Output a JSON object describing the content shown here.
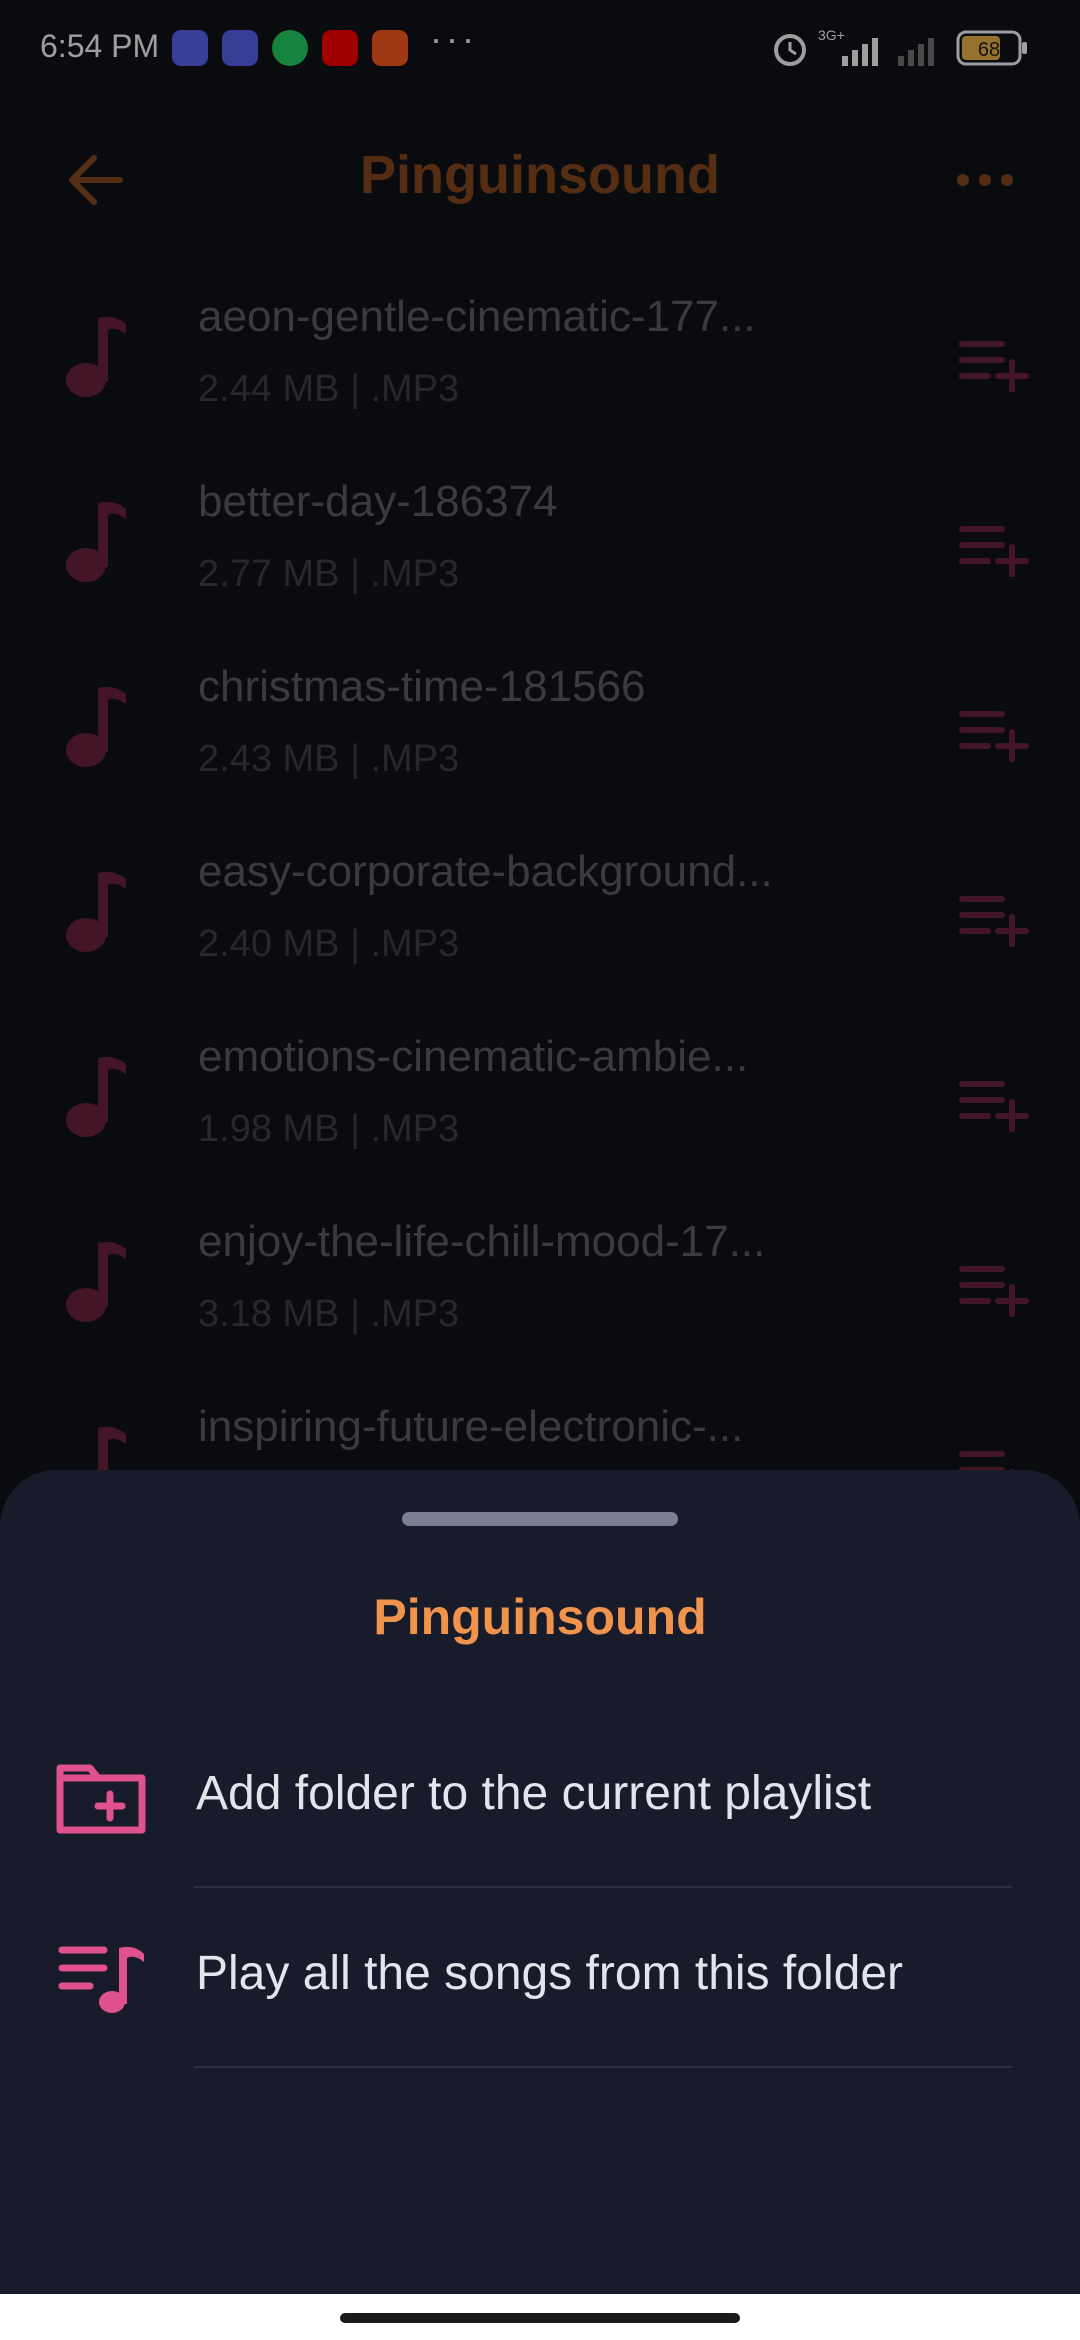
{
  "status_bar": {
    "time": "6:54 PM",
    "notifications": [
      "discord-icon",
      "discord-icon",
      "whatsapp-icon",
      "youtube-icon",
      "app-icon"
    ],
    "more": "···",
    "network": "3G+",
    "battery": "68"
  },
  "header": {
    "title": "Pinguinsound"
  },
  "songs": [
    {
      "name": "aeon-gentle-cinematic-177...",
      "meta": "2.44 MB  |  .MP3"
    },
    {
      "name": "better-day-186374",
      "meta": "2.77 MB  |  .MP3"
    },
    {
      "name": "christmas-time-181566",
      "meta": "2.43 MB  |  .MP3"
    },
    {
      "name": "easy-corporate-background...",
      "meta": "2.40 MB  |  .MP3"
    },
    {
      "name": "emotions-cinematic-ambie...",
      "meta": "1.98 MB  |  .MP3"
    },
    {
      "name": "enjoy-the-life-chill-mood-17...",
      "meta": "3.18 MB  |  .MP3"
    },
    {
      "name": "inspiring-future-electronic-...",
      "meta": ""
    }
  ],
  "sheet": {
    "title": "Pinguinsound",
    "options": [
      {
        "label": "Add folder to the current playlist",
        "icon": "folder-add-icon"
      },
      {
        "label": "Play all the songs from this folder",
        "icon": "playlist-play-icon"
      }
    ]
  },
  "colors": {
    "accent_orange": "#f0944d",
    "accent_pink": "#e0528f",
    "sheet_bg": "#181b2a",
    "app_bg": "#101219"
  }
}
